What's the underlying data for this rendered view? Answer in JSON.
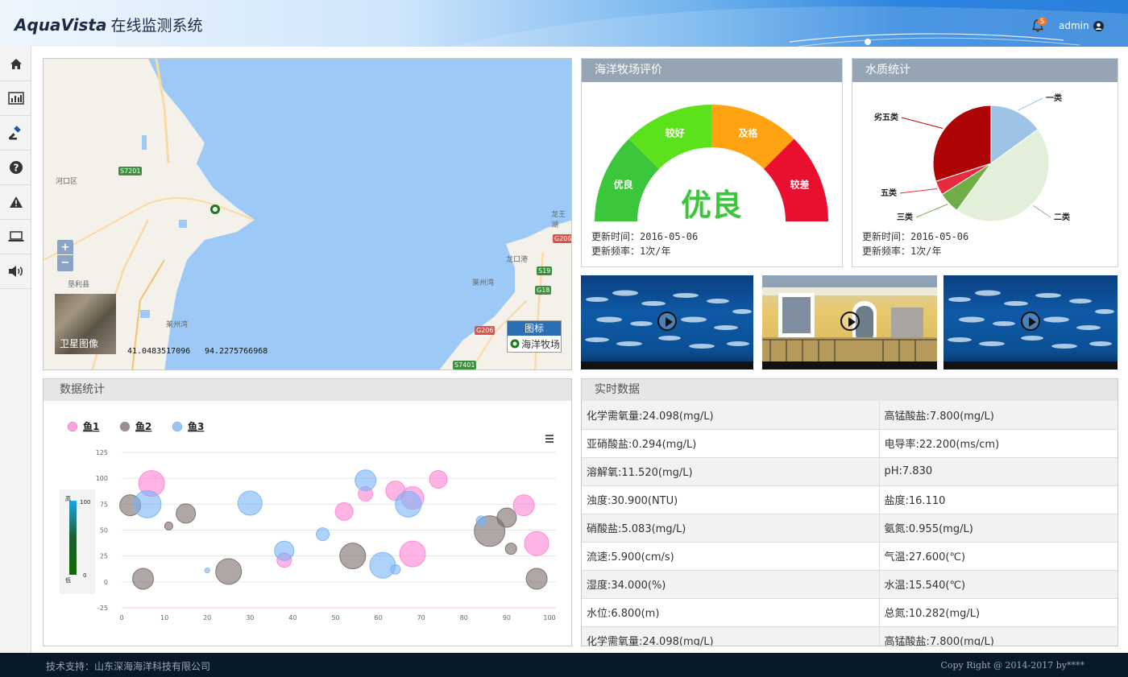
{
  "header": {
    "brand": "AquaVista",
    "system_name": "在线监测系统",
    "notification_count": "5",
    "username": "admin"
  },
  "sidebar": {
    "items": [
      {
        "icon": "home-icon"
      },
      {
        "icon": "bar-chart-icon"
      },
      {
        "icon": "gavel-icon"
      },
      {
        "icon": "help-icon"
      },
      {
        "icon": "warning-icon"
      },
      {
        "icon": "laptop-icon"
      },
      {
        "icon": "volume-icon"
      }
    ]
  },
  "map": {
    "satellite_label": "卫星图像",
    "lat": "41.0483517096",
    "lng": "94.2275766968",
    "legend_title": "图标",
    "legend_item": "海洋牧场",
    "zoom_in": "+",
    "zoom_out": "−",
    "place_labels": [
      "河口区",
      "垦利县",
      "莱州湾",
      "龙王湖",
      "龙口港",
      "莱州湾"
    ],
    "road_signs": [
      "S7201",
      "G206",
      "S19",
      "G18",
      "G206",
      "S7401"
    ]
  },
  "gauge": {
    "title": "海洋牧场评价",
    "segments": [
      "优良",
      "较好",
      "及格",
      "较差"
    ],
    "value_label": "优良",
    "update_time": "更新时间：2016-05-06",
    "update_freq": "更新频率：1次/年",
    "colors": {
      "excellent": "#3cc63c",
      "good": "#5ce21a",
      "pass": "#ffa313",
      "poor": "#e8102e"
    }
  },
  "pie": {
    "title": "水质统计",
    "update_time": "更新时间：2016-05-06",
    "update_freq": "更新频率：1次/年",
    "chart_data": {
      "type": "pie",
      "slices": [
        {
          "label": "一类",
          "value": 15,
          "color": "#9dc3e6"
        },
        {
          "label": "二类",
          "value": 45,
          "color": "#e2efd9"
        },
        {
          "label": "三类",
          "value": 6,
          "color": "#70ad47"
        },
        {
          "label": "五类",
          "value": 4,
          "color": "#e82b3c"
        },
        {
          "label": "劣五类",
          "value": 30,
          "color": "#ad0505"
        }
      ]
    }
  },
  "videos": [
    {
      "name": "fish-video-1"
    },
    {
      "name": "building-video"
    },
    {
      "name": "fish-video-2"
    }
  ],
  "stats": {
    "title": "数据统计",
    "menu_icon": "menu-icon",
    "chart_data": {
      "type": "scatter",
      "bubble": true,
      "xlim": [
        0,
        100
      ],
      "ylim": [
        -25,
        125
      ],
      "x_ticks": [
        0,
        10,
        20,
        30,
        40,
        50,
        60,
        70,
        80,
        90,
        100
      ],
      "y_ticks": [
        -25,
        0,
        25,
        50,
        75,
        100,
        125
      ],
      "color_scale": {
        "high_label": "高",
        "low_label": "低",
        "max": "100",
        "min": "0"
      },
      "series": [
        {
          "name": "鱼1",
          "color": "#ff82d6",
          "points": [
            [
              7,
              95,
              16
            ],
            [
              38,
              21,
              9
            ],
            [
              52,
              68,
              11
            ],
            [
              57,
              85,
              9
            ],
            [
              64,
              88,
              12
            ],
            [
              68,
              81,
              14
            ],
            [
              68,
              27,
              16
            ],
            [
              74,
              99,
              11
            ],
            [
              94,
              74,
              13
            ],
            [
              97,
              37,
              15
            ]
          ]
        },
        {
          "name": "鱼2",
          "color": "#7a6a6a",
          "points": [
            [
              2,
              74,
              13
            ],
            [
              5,
              3,
              13
            ],
            [
              11,
              54,
              5
            ],
            [
              15,
              66,
              12
            ],
            [
              25,
              10,
              16
            ],
            [
              54,
              25,
              16
            ],
            [
              86,
              49,
              19
            ],
            [
              90,
              62,
              12
            ],
            [
              91,
              32,
              7
            ],
            [
              97,
              3,
              13
            ]
          ]
        },
        {
          "name": "鱼3",
          "color": "#78b4f5",
          "points": [
            [
              6,
              75,
              17
            ],
            [
              20,
              11,
              3
            ],
            [
              30,
              76,
              15
            ],
            [
              38,
              30,
              12
            ],
            [
              47,
              46,
              8
            ],
            [
              57,
              98,
              13
            ],
            [
              61,
              16,
              16
            ],
            [
              64,
              12,
              6
            ],
            [
              67,
              75,
              16
            ],
            [
              84,
              59,
              6
            ]
          ]
        }
      ]
    }
  },
  "realtime": {
    "title": "实时数据",
    "rows": [
      [
        "化学需氧量:24.098(mg/L)",
        "高锰酸盐:7.800(mg/L)"
      ],
      [
        "亚硝酸盐:0.294(mg/L)",
        "电导率:22.200(ms/cm)"
      ],
      [
        "溶解氧:11.520(mg/L)",
        "pH:7.830"
      ],
      [
        "浊度:30.900(NTU)",
        "盐度:16.110"
      ],
      [
        "硝酸盐:5.083(mg/L)",
        "氨氮:0.955(mg/L)"
      ],
      [
        "流速:5.900(cm/s)",
        "气温:27.600(℃)"
      ],
      [
        "湿度:34.000(%)",
        "水温:15.540(℃)"
      ],
      [
        "水位:6.800(m)",
        "总氮:10.282(mg/L)"
      ],
      [
        "化学需氧量:24.098(mg/L)",
        "高锰酸盐:7.800(mg/L)"
      ]
    ]
  },
  "footer": {
    "support": "技术支持：山东深海海洋科技有限公司",
    "copyright": "Copy Right @ 2014-2017 by****"
  }
}
